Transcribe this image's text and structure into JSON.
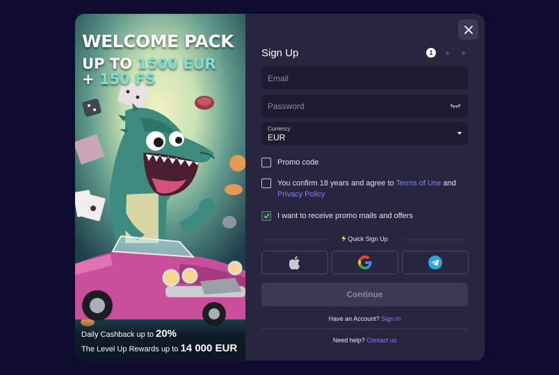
{
  "promo": {
    "title": "WELCOME PACK",
    "line1_prefix": "UP TO ",
    "line1_amount": "1500 EUR",
    "line2_prefix": "+ ",
    "line2_amount": "150 FS",
    "perk1_text": "Daily Cashback up to ",
    "perk1_value": "20%",
    "perk2_text": "The Level Up Rewards up to ",
    "perk2_value": "14 000 EUR"
  },
  "form": {
    "title": "Sign Up",
    "steps": [
      "1",
      "",
      ""
    ],
    "email_placeholder": "Email",
    "password_placeholder": "Password",
    "currency_label": "Currency",
    "currency_value": "EUR",
    "promo_code_label": "Promo code",
    "age_text_1": "You confirm 18 years and agree to ",
    "terms_link": "Terms of Use",
    "age_text_2": " and ",
    "privacy_link": "Privacy Policy",
    "promo_mails_label": "I want to receive promo mails and offers",
    "quick_signup": "Quick Sign Up",
    "continue_label": "Continue",
    "have_account": "Have an Account? ",
    "sign_in_link": "Sign In",
    "need_help": "Need help? ",
    "contact_link": "Contact us"
  },
  "checkboxes": {
    "promo_code": false,
    "age_confirm": false,
    "promo_mails": true
  },
  "icons": [
    "close-icon",
    "eye-closed-icon",
    "chevron-down-icon",
    "check-icon",
    "bolt-icon",
    "apple-icon",
    "google-icon",
    "telegram-icon"
  ],
  "colors": {
    "accent": "#8a7dff",
    "promo_green": "#7fe0d6",
    "background": "#0d0b2e",
    "panel": "#26263e"
  }
}
